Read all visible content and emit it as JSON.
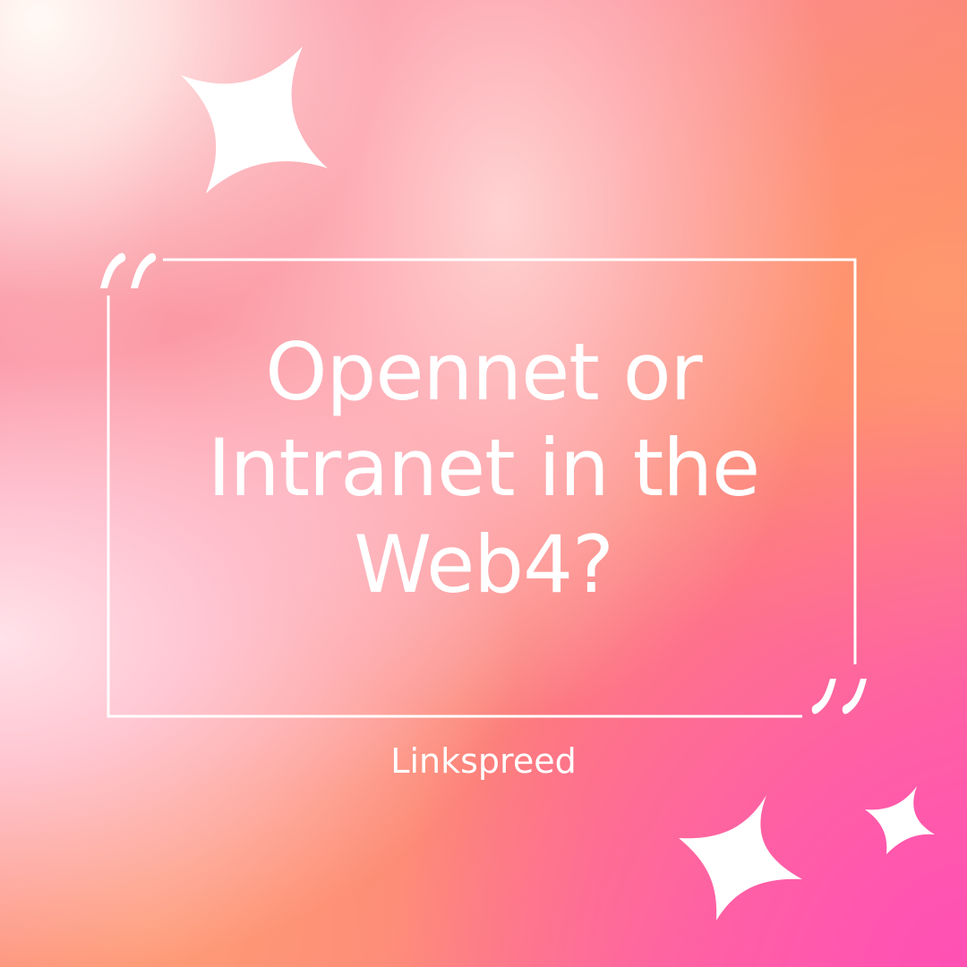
{
  "headline": {
    "line1": "Opennet or",
    "line2": "Intranet in the",
    "line3": "Web4?"
  },
  "brand": "Linkspreed",
  "icons": {
    "sparkles": [
      "sparkle-icon",
      "sparkle-icon",
      "sparkle-icon"
    ],
    "quotes": [
      "open-quote-icon",
      "close-quote-icon"
    ]
  },
  "colors": {
    "text": "#ffffff",
    "frame": "#ffffff",
    "background_top_left": "#fff6f2",
    "background_center": "#fc8070",
    "background_bottom_right": "#ff5fb0"
  }
}
